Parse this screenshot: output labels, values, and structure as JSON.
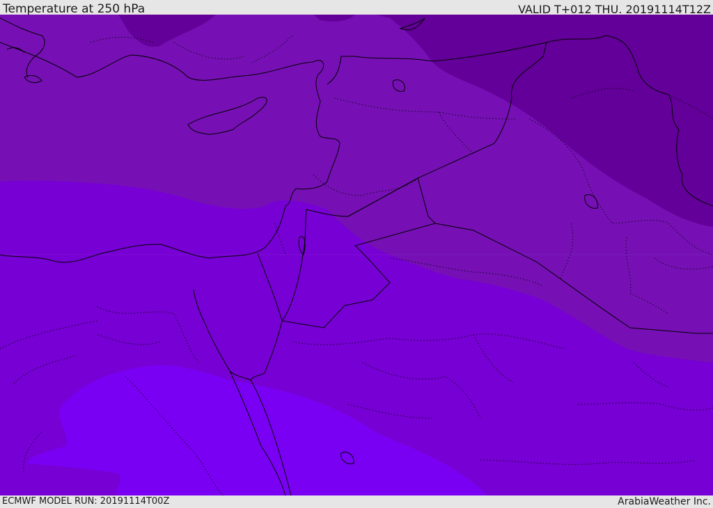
{
  "header": {
    "title": "Temperature at 250 hPa",
    "valid": "VALID T+012 THU. 20191114T12Z"
  },
  "footer": {
    "model_run": "ECMWF MODEL RUN: 20191114T00Z",
    "brand": "ArabiaWeather Inc."
  },
  "colors": {
    "band_darkest": "#630099",
    "band_dark": "#7610b4",
    "band_mid": "#7700d4",
    "band_light": "#7a00f4",
    "boundary": "#000000"
  }
}
